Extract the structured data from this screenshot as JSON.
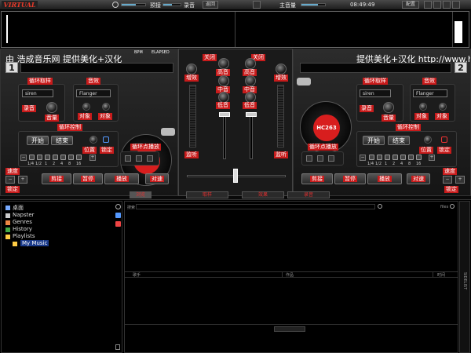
{
  "topbar": {
    "logo": "VIRTUAL DJ",
    "cue_label": "预接",
    "record_label": "录音",
    "btn_label": "返回",
    "master_label": "主音量",
    "time": "08:49:49",
    "config_label": "配置"
  },
  "deck1": {
    "title": "由 浩成音乐网 提供美化+汉化",
    "number": "1",
    "bpm_label": "BPM",
    "elapsed_label": "ELAPSED",
    "loop_sampler": "循环取样",
    "effect": "音效",
    "loop_select": "siren",
    "effect_select": "Flanger",
    "record": "录音",
    "volume": "音量",
    "target": "对象",
    "platter_label": "HC263",
    "loop_control": "循环控制",
    "start": "开始",
    "end": "结束",
    "position": "位置",
    "lock": "锁定",
    "fractions": [
      "1/4",
      "1/2",
      "1",
      "2",
      "4",
      "8",
      "16"
    ],
    "loop_play": "循环点播放",
    "speed": "速度",
    "cue": "剪接",
    "pause": "暂停",
    "play": "播放",
    "sync": "对速"
  },
  "deck2": {
    "title": "提供美化+汉化  http://www.hc2",
    "number": "2",
    "loop_sampler": "循环取样",
    "effect": "音效",
    "loop_select": "siren",
    "effect_select": "Flanger",
    "record": "录音",
    "volume": "音量",
    "target": "对象",
    "platter_label": "HC263",
    "loop_control": "循环控制",
    "start": "开始",
    "end": "结束",
    "position": "位置",
    "lock": "锁定",
    "fractions": [
      "1/4",
      "1/2",
      "1",
      "2",
      "4",
      "8",
      "16"
    ],
    "loop_play": "循环点播放",
    "speed": "速度",
    "cue": "剪接",
    "pause": "暂停",
    "play": "播放",
    "sync": "对速"
  },
  "mixer": {
    "close": "关闭",
    "gain": "增效",
    "high": "高音",
    "mid": "中音",
    "low": "低音",
    "monitor": "监听"
  },
  "tabs": [
    "浏览",
    "取样",
    "效果",
    "录音"
  ],
  "browser": {
    "tree": [
      "桌面",
      "Napster",
      "Genres",
      "History",
      "Playlists",
      "My Music"
    ],
    "search_label": "搜索",
    "files_label": "files",
    "col_artist": "歌手",
    "col_title": "作品",
    "col_time": "时间",
    "side_label": "SIDELIST"
  },
  "colors": {
    "accent_red": "#c81b1b",
    "background": "#0a0a0a"
  }
}
